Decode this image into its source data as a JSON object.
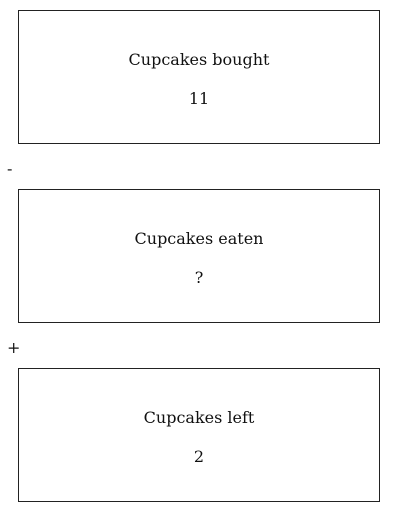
{
  "boxes": [
    {
      "label": "Cupcakes bought",
      "value": "11"
    },
    {
      "label": "Cupcakes eaten",
      "value": "?"
    },
    {
      "label": "Cupcakes left",
      "value": "2"
    }
  ],
  "operators": [
    "-",
    "+"
  ]
}
